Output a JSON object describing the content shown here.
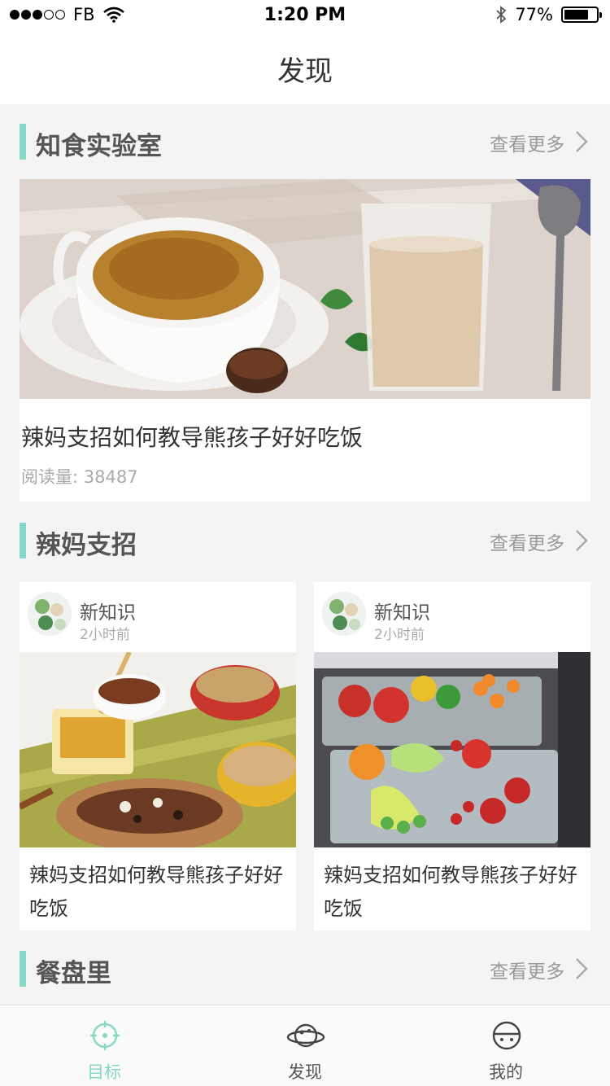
{
  "status_bar": {
    "carrier": "FB",
    "time": "1:20 PM",
    "battery": "77%",
    "battery_level": 0.77,
    "signal_bars_filled": 3,
    "signal_bars_total": 5
  },
  "nav": {
    "title": "发现"
  },
  "colors": {
    "accent": "#86d7c3"
  },
  "sections": [
    {
      "title": "知食实验室",
      "more": "查看更多"
    },
    {
      "title": "辣妈支招",
      "more": "查看更多"
    },
    {
      "title": "餐盘里",
      "more": "查看更多"
    }
  ],
  "feature": {
    "title": "辣妈支招如何教导熊孩子好好吃饭",
    "reads_label": "阅读量: 38487"
  },
  "cards": [
    {
      "author": "新知识",
      "ago": "2小时前",
      "title": "辣妈支招如何教导熊孩子好好吃饭"
    },
    {
      "author": "新知识",
      "ago": "2小时前",
      "title": "辣妈支招如何教导熊孩子好好吃饭"
    }
  ],
  "tabs": [
    {
      "label": "目标",
      "icon": "target-icon",
      "active": true
    },
    {
      "label": "发现",
      "icon": "planet-icon",
      "active": false
    },
    {
      "label": "我的",
      "icon": "profile-icon",
      "active": false
    }
  ]
}
